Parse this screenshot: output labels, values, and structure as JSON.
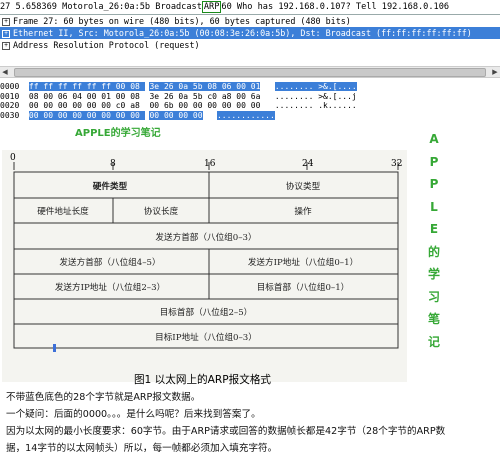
{
  "packet_row": {
    "number": "27",
    "time": "5.658369",
    "source": "Motorola_26:0a:5b",
    "destination": "Broadcast",
    "protocol": "ARP",
    "info": "60 Who has 192.168.0.107?  Tell 192.168.0.106"
  },
  "tree": [
    {
      "expander": "+",
      "text": "Frame 27: 60 bytes on wire (480 bits), 60 bytes captured (480 bits)",
      "selected": false
    },
    {
      "expander": "+",
      "text": "Ethernet II, Src: Motorola_26:0a:5b (00:08:3e:26:0a:5b), Dst: Broadcast (ff:ff:ff:ff:ff:ff)",
      "selected": true
    },
    {
      "expander": "+",
      "text": "Address Resolution Protocol (request)",
      "selected": false
    }
  ],
  "hex_rows": [
    {
      "offset": "0000",
      "bytes": "ff ff ff ff ff ff 00 08  3e 26 0a 5b 08 06 00 01",
      "ascii": "........ >&.[....",
      "hl_end": 16
    },
    {
      "offset": "0010",
      "bytes": "08 00 06 04 00 01 00 08  3e 26 0a 5b c0 a8 00 6a",
      "ascii": "........ >&.[...j",
      "hl_end": 0
    },
    {
      "offset": "0020",
      "bytes": "00 00 00 00 00 00 c0 a8  00 6b 00 00 00 00 00 00",
      "ascii": "........ .k......",
      "hl_end": 0
    },
    {
      "offset": "0030",
      "bytes": "00 00 00 00 00 00 00 00  00 00 00 00",
      "ascii": "............",
      "hl_end": 12
    }
  ],
  "note_title": "APPLE的学习笔记",
  "vertical_text": [
    "A",
    "P",
    "P",
    "L",
    "E",
    "的",
    "学",
    "习",
    "笔",
    "记"
  ],
  "diagram": {
    "bit_marks": [
      "0",
      "8",
      "16",
      "24",
      "32"
    ],
    "rows": [
      [
        "硬件类型",
        "协议类型"
      ],
      [
        "硬件地址长度",
        "协议长度",
        "操作"
      ],
      [
        "发送方首部（八位组0–3）"
      ],
      [
        "发送方首部（八位组4–5）",
        "发送方IP地址（八位组0–1）"
      ],
      [
        "发送方IP地址（八位组2–3）",
        "目标首部（八位组0–1）"
      ],
      [
        "目标首部（八位组2–5）"
      ],
      [
        "目标IP地址（八位组0–3）"
      ]
    ]
  },
  "caption": "图1 以太网上的ARP报文格式",
  "paragraphs": [
    "不带蓝色底色的28个字节就是ARP报文数据。",
    "一个疑问：后面的0000。。。是什么吗呢？后来找到答案了。",
    "因为以太网的最小长度要求：60字节。由于ARP请求或回答的数据帧长都是42字节（28个字节的ARP数",
    "据，14字节的以太网帧头）所以，每一帧都必须加入填充字符。"
  ],
  "colors": {
    "selection": "#3c7fd8",
    "note_green": "#36a836",
    "arp_box": "#1a8a1a"
  }
}
